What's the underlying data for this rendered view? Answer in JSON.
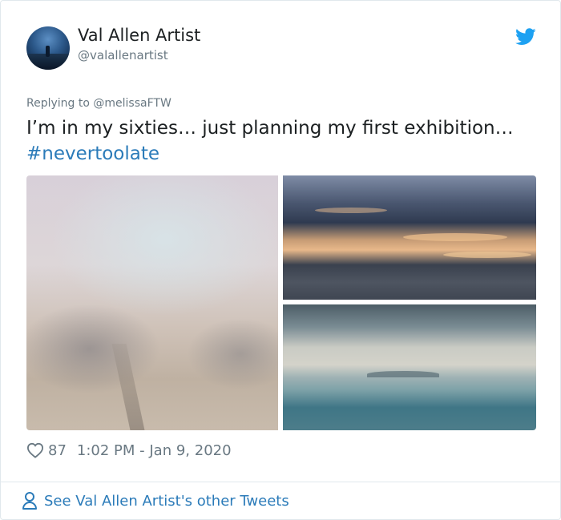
{
  "author": {
    "display_name": "Val Allen Artist",
    "handle": "@valallenartist"
  },
  "reply_context": {
    "prefix": "Replying to",
    "mention": "@melissaFTW"
  },
  "tweet": {
    "text": "I’m in my sixties… just planning my first exhibition…",
    "hashtag": "#nevertoolate"
  },
  "media": {
    "count": 3
  },
  "meta": {
    "likes": "87",
    "timestamp": "1:02 PM - Jan 9, 2020"
  },
  "footer": {
    "other_tweets_label": "See Val Allen Artist's other Tweets"
  },
  "icons": {
    "brand": "twitter-bird-icon",
    "like": "heart-icon",
    "profile": "person-icon"
  },
  "colors": {
    "link": "#2b7bb9",
    "twitter_blue": "#1da1f2",
    "muted_text": "#697882",
    "border": "#e1e8ed"
  }
}
